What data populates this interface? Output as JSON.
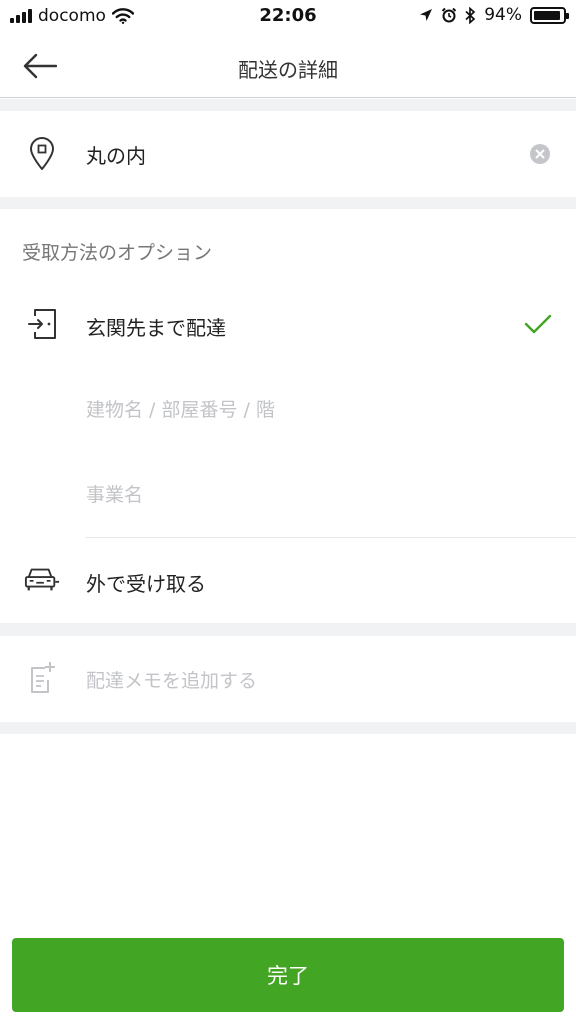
{
  "status_bar": {
    "carrier": "docomo",
    "time": "22:06",
    "battery": "94%",
    "battery_level": 0.94,
    "icons": [
      "signal-icon",
      "wifi-icon",
      "location-arrow-icon",
      "alarm-icon",
      "bluetooth-icon",
      "battery-icon"
    ]
  },
  "nav": {
    "title": "配送の詳細",
    "back_icon": "arrow-left-icon"
  },
  "address": {
    "icon": "location-pin-icon",
    "value": "丸の内",
    "clear_icon": "clear-circle-icon"
  },
  "options": {
    "section_title": "受取方法のオプション",
    "door": {
      "icon": "door-icon",
      "label": "玄関先まで配達",
      "selected": true,
      "check_icon": "checkmark-icon",
      "check_color": "#43a524"
    },
    "building_placeholder": "建物名 / 部屋番号 / 階",
    "business_placeholder": "事業名",
    "outside": {
      "icon": "car-icon",
      "label": "外で受け取る"
    }
  },
  "memo": {
    "icon": "note-add-icon",
    "label": "配達メモを追加する"
  },
  "done_button": {
    "label": "完了",
    "color": "#43a524"
  }
}
